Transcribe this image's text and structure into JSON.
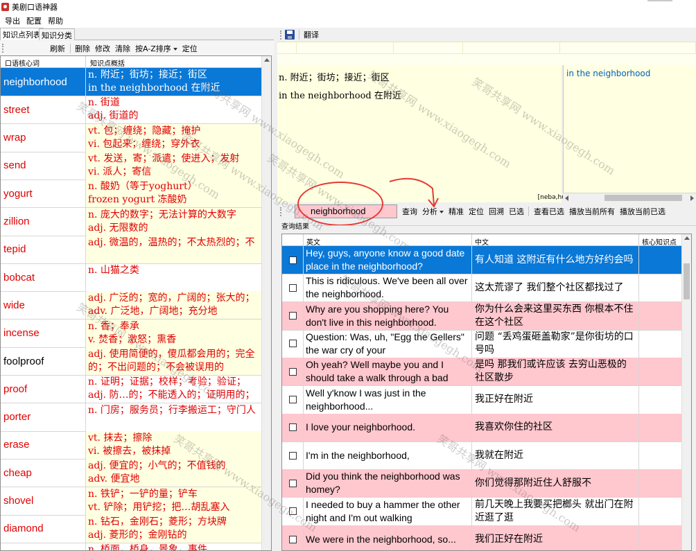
{
  "window": {
    "title": "美剧口语神器"
  },
  "menu": [
    "导出",
    "配置",
    "帮助"
  ],
  "left_panel": {
    "tabs": [
      "知识点列表",
      "知识分类"
    ],
    "toolbar": [
      "刷新",
      "删除",
      "修改",
      "清除",
      "按A-Z排序",
      "定位"
    ],
    "columns": [
      "口语核心词",
      "知识点概括"
    ],
    "rows": [
      {
        "word": "neighborhood",
        "lines": [
          "n. 附近；街坊；接近；街区",
          "in the neighborhood 在附近"
        ]
      },
      {
        "word": "street",
        "lines": [
          "n. 街道",
          "adj. 街道的"
        ]
      },
      {
        "word": "wrap",
        "lines": [
          "vt. 包；缠绕；隐藏；掩护",
          "vi. 包起来；缠绕；穿外衣"
        ]
      },
      {
        "word": "send",
        "lines": [
          "vt. 发送，寄；派遣；使进入；发射",
          "vi. 派人；寄信"
        ]
      },
      {
        "word": "yogurt",
        "lines": [
          "n. 酸奶（等于yoghurt）",
          "frozen yogurt 冻酸奶"
        ]
      },
      {
        "word": "zillion",
        "lines": [
          "n. 庞大的数字；无法计算的大数字",
          "adj. 无限数的"
        ]
      },
      {
        "word": "tepid",
        "lines": [
          "adj. 微温的，温热的；不太热烈的；不"
        ]
      },
      {
        "word": "bobcat",
        "lines": [
          "n. 山猫之类"
        ]
      },
      {
        "word": "wide",
        "lines": [
          "adj. 广泛的；宽的，广阔的；张大的；",
          "adv. 广泛地，广阔地；充分地"
        ]
      },
      {
        "word": "incense",
        "lines": [
          "n. 香；奉承",
          "v. 焚香；激怒；熏香"
        ]
      },
      {
        "word": "foolproof",
        "lines": [
          "adj. 使用简便的，傻瓜都会用的；完全",
          "的；不出问题的；不会被误用的"
        ]
      },
      {
        "word": "proof",
        "lines": [
          "n. 证明；证据；校样；考验；验证；",
          "adj. 防…的；不能透入的；证明用的；"
        ]
      },
      {
        "word": "porter",
        "lines": [
          "n. 门房；服务员；行李搬运工；守门人"
        ]
      },
      {
        "word": "erase",
        "lines": [
          "vt. 抹去；擦除",
          "vi. 被擦去，被抹掉"
        ]
      },
      {
        "word": "cheap",
        "lines": [
          "adj. 便宜的；小气的；不值钱的",
          "adv. 便宜地"
        ]
      },
      {
        "word": "shovel",
        "lines": [
          "n. 铁铲；一铲的量；铲车",
          "vt. 铲除；用铲挖；把…胡乱塞入"
        ]
      },
      {
        "word": "diamond",
        "lines": [
          "n. 钻石，金刚石；菱形；方块牌",
          "adj. 菱形的；金刚钻的"
        ]
      },
      {
        "word": "",
        "lines": [
          "n. 桥面，桥身，景象，事件"
        ]
      }
    ]
  },
  "right_panel": {
    "toolbar": [
      "翻译"
    ],
    "definition": [
      "n. 附近；街坊；接近；街区",
      "in the neighborhood 在附近"
    ],
    "phrase": "in the neighborhood",
    "phonetic": "[nebə,hʊd]",
    "search": {
      "value": "neighborhood",
      "actions": [
        "查询",
        "分析",
        "精准",
        "定位",
        "回溯",
        "已选",
        "查看已选",
        "播放当前所有",
        "播放当前已选"
      ]
    },
    "results_label": "查询结果",
    "columns": [
      "",
      "英文",
      "中文",
      "核心知识点"
    ],
    "results": [
      {
        "en": "Hey, guys, anyone know a good date place in the neighborhood?",
        "zh": "有人知道 这附近有什么地方好约会吗"
      },
      {
        "en": "This is ridiculous. We've been all over the neighborhood.",
        "zh": "这太荒谬了 我们整个社区都找过了"
      },
      {
        "en": "Why are you shopping here? You don't live in this neighborhood.",
        "zh": "你为什么会来这里买东西 你根本不住在这个社区"
      },
      {
        "en": "Question: Was, uh, \"Egg the Gellers\" the war cry of your",
        "zh": "问题 “丢鸡蛋砸盖勒家”是你街坊的口号吗"
      },
      {
        "en": "Oh yeah? Well maybe you and I should take a walk through a bad",
        "zh": "是吗 那我们或许应该 去穷山恶极的社区散步"
      },
      {
        "en": "Well y'know I was just in the neighborhood...",
        "zh": "我正好在附近"
      },
      {
        "en": "I love your neighborhood.",
        "zh": "我喜欢你住的社区"
      },
      {
        "en": "I'm in the neighborhood,",
        "zh": "我就在附近"
      },
      {
        "en": "Did you think the neighborhood was homey?",
        "zh": "你们觉得那附近住人舒服不"
      },
      {
        "en": "I needed to buy a hammer the other night and I'm out walking",
        "zh": "前几天晚上我要买把榔头 就出门在附近逛了逛"
      },
      {
        "en": "We were in the neighborhood, so...",
        "zh": "我们正好在附近"
      }
    ]
  },
  "watermarks": [
    "笑哥共享网 www.xiaogegh.com"
  ],
  "colors": {
    "selected": "#0a78d7",
    "word_red": "#e00000",
    "row_yellow": "#ffffe1",
    "row_pink": "#ffc7ce",
    "annotation": "#e53935"
  }
}
